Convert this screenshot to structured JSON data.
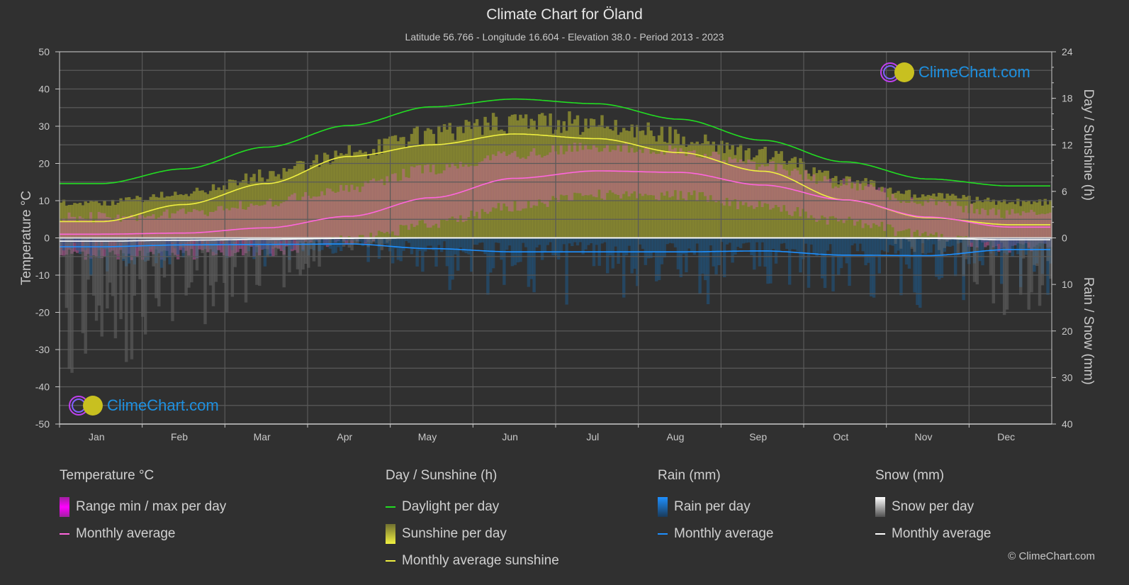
{
  "header": {
    "title": "Climate Chart for Öland",
    "subtitle": "Latitude 56.766 - Longitude 16.604 - Elevation 38.0 - Period 2013 - 2023"
  },
  "logo": {
    "text": "ClimeChart.com"
  },
  "copyright": "© ClimeChart.com",
  "colors": {
    "background": "#303030",
    "daylight": "#22dd22",
    "sunshine_avg": "#f0f040",
    "temp_avg": "#ff66dd",
    "rain_avg": "#1e90ff",
    "snow_avg": "#ffffff",
    "sunshine_fill": "#8c8c30",
    "temp_fill": "#d060b0",
    "rain_fill": "#1e5a8a",
    "snow_fill": "#707070"
  },
  "legend": {
    "temperature": {
      "title": "Temperature °C",
      "items": [
        "Range min / max per day",
        "Monthly average"
      ]
    },
    "sunshine": {
      "title": "Day / Sunshine (h)",
      "items": [
        "Daylight per day",
        "Sunshine per day",
        "Monthly average sunshine"
      ]
    },
    "rain": {
      "title": "Rain (mm)",
      "items": [
        "Rain per day",
        "Monthly average"
      ]
    },
    "snow": {
      "title": "Snow (mm)",
      "items": [
        "Snow per day",
        "Monthly average"
      ]
    }
  },
  "chart_data": {
    "type": "line",
    "title": "Climate Chart for Öland",
    "categories": [
      "Jan",
      "Feb",
      "Mar",
      "Apr",
      "May",
      "Jun",
      "Jul",
      "Aug",
      "Sep",
      "Oct",
      "Nov",
      "Dec"
    ],
    "left_axis": {
      "label": "Temperature °C",
      "range": [
        -50,
        50
      ],
      "ticks": [
        50,
        40,
        30,
        20,
        10,
        0,
        -10,
        -20,
        -30,
        -40,
        -50
      ]
    },
    "right_axis_top": {
      "label": "Day / Sunshine (h)",
      "range": [
        0,
        24
      ],
      "ticks": [
        24,
        18,
        12,
        6,
        0
      ]
    },
    "right_axis_bottom": {
      "label": "Rain / Snow (mm)",
      "range": [
        0,
        40
      ],
      "ticks": [
        0,
        10,
        20,
        30,
        40
      ]
    },
    "grid": true,
    "series": [
      {
        "name": "Daylight per day",
        "axis": "hours",
        "values": [
          7.0,
          8.9,
          11.7,
          14.5,
          16.9,
          17.9,
          17.3,
          15.3,
          12.6,
          9.8,
          7.6,
          6.7
        ]
      },
      {
        "name": "Monthly average sunshine",
        "axis": "hours",
        "values": [
          2.1,
          4.3,
          7.0,
          10.5,
          12.0,
          13.4,
          12.8,
          11.0,
          8.6,
          4.9,
          2.6,
          1.7
        ]
      },
      {
        "name": "Temperature monthly average",
        "axis": "celsius",
        "values": [
          1.0,
          1.3,
          2.7,
          5.8,
          10.8,
          16.0,
          18.0,
          17.6,
          14.2,
          10.2,
          5.6,
          2.9
        ]
      },
      {
        "name": "Rain monthly average",
        "axis": "mm",
        "values": [
          1.9,
          1.5,
          1.4,
          1.3,
          2.3,
          3.0,
          3.0,
          3.0,
          2.8,
          3.7,
          3.8,
          2.5
        ]
      },
      {
        "name": "Snow monthly average",
        "axis": "mm",
        "values": [
          0.7,
          0.5,
          0.3,
          0.1,
          0.0,
          0.0,
          0.0,
          0.0,
          0.0,
          0.0,
          0.1,
          0.4
        ]
      },
      {
        "name": "Temperature range min",
        "axis": "celsius",
        "values": [
          -3,
          -3,
          -2,
          1,
          5,
          10,
          13,
          13,
          10,
          6,
          2,
          -1
        ]
      },
      {
        "name": "Temperature range max",
        "axis": "celsius",
        "values": [
          4,
          5,
          8,
          12,
          17,
          21,
          23,
          22,
          18,
          13,
          8,
          5
        ]
      },
      {
        "name": "Sunshine per day (max envelope)",
        "axis": "hours",
        "values": [
          4.8,
          6.0,
          8.5,
          11.5,
          14.0,
          15.8,
          15.5,
          13.8,
          11.2,
          8.0,
          5.6,
          4.8
        ]
      }
    ]
  }
}
